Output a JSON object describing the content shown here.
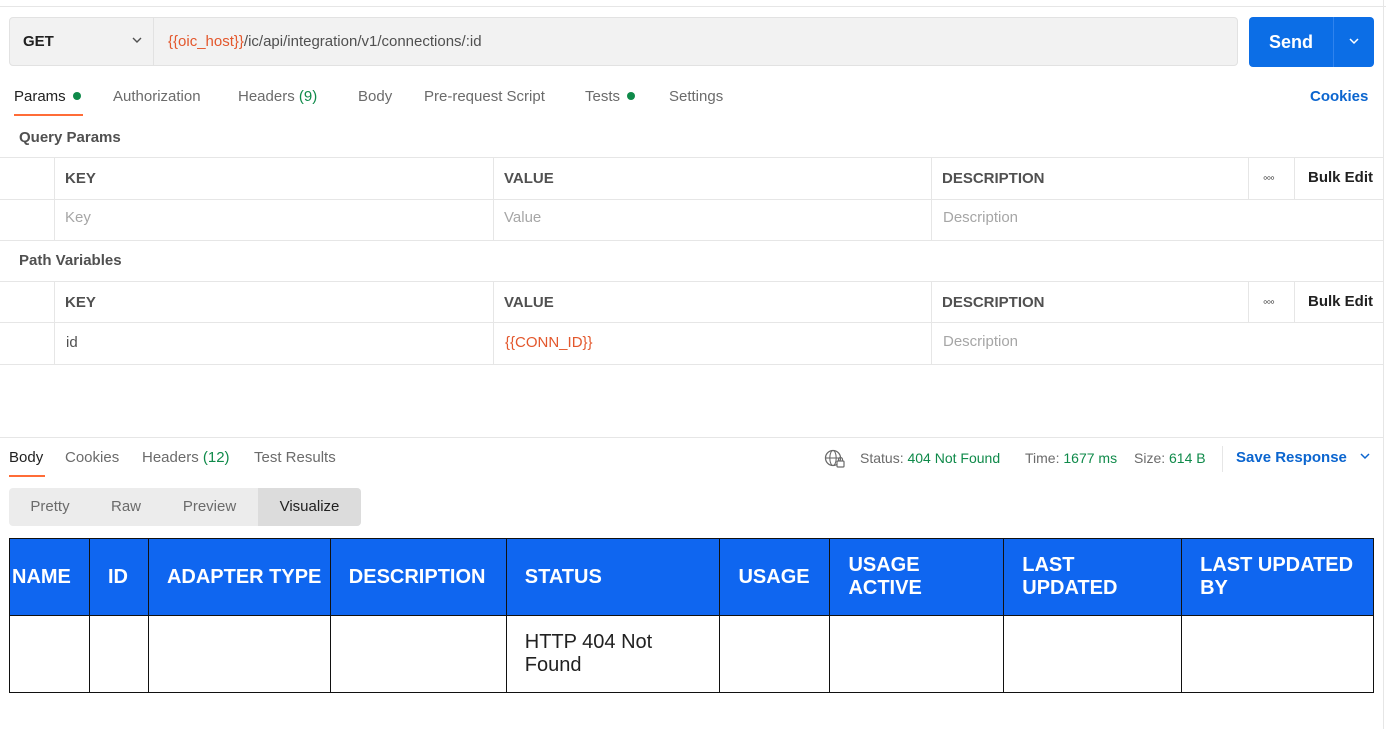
{
  "request": {
    "method": "GET",
    "url_var": "{{oic_host}}",
    "url_rest": "/ic/api/integration/v1/connections/:id",
    "send_label": "Send"
  },
  "req_tabs": {
    "params": "Params",
    "authorization": "Authorization",
    "headers": "Headers",
    "headers_count": "(9)",
    "body": "Body",
    "prerequest": "Pre-request Script",
    "tests": "Tests",
    "settings": "Settings",
    "cookies": "Cookies"
  },
  "query_params": {
    "title": "Query Params",
    "col_key": "KEY",
    "col_value": "VALUE",
    "col_description": "DESCRIPTION",
    "bulk_edit": "Bulk Edit",
    "placeholder_key": "Key",
    "placeholder_value": "Value",
    "placeholder_description": "Description"
  },
  "path_variables": {
    "title": "Path Variables",
    "col_key": "KEY",
    "col_value": "VALUE",
    "col_description": "DESCRIPTION",
    "bulk_edit": "Bulk Edit",
    "row_key": "id",
    "row_value": "{{CONN_ID}}",
    "placeholder_description": "Description"
  },
  "response": {
    "tabs": {
      "body": "Body",
      "cookies": "Cookies",
      "headers": "Headers",
      "headers_count": "(12)",
      "test_results": "Test Results"
    },
    "status_label": "Status:",
    "status_value": "404 Not Found",
    "time_label": "Time:",
    "time_value": "1677 ms",
    "size_label": "Size:",
    "size_value": "614 B",
    "save_response": "Save Response",
    "view_modes": [
      "Pretty",
      "Raw",
      "Preview",
      "Visualize"
    ],
    "active_view": "Visualize"
  },
  "visualize_table": {
    "headers": [
      "NAME",
      "ID",
      "ADAPTER TYPE",
      "DESCRIPTION",
      "STATUS",
      "USAGE",
      "USAGE ACTIVE",
      "LAST UPDATED",
      "LAST UPDATED BY"
    ],
    "row": [
      "",
      "",
      "",
      "",
      "HTTP 404 Not Found",
      "",
      "",
      "",
      ""
    ]
  },
  "colors": {
    "accent": "#0c6ee6",
    "tab_underline": "#ff6c37",
    "variable": "#e3572c",
    "success": "#0f8a4a",
    "table_header": "#0f66f0"
  }
}
